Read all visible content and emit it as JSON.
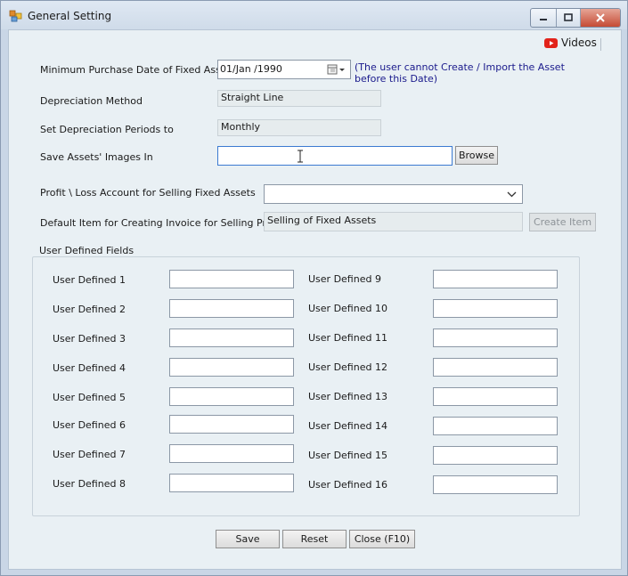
{
  "window": {
    "title": "General Setting",
    "videos_label": "Videos",
    "colors": {
      "titlebar": "#d5e0ec",
      "client": "#e9f0f4",
      "note": "#1a1a8c",
      "youtube": "#e2231a"
    }
  },
  "form": {
    "min_purchase_date": {
      "label": "Minimum Purchase Date of Fixed Assets",
      "value": "01/Jan /1990",
      "note": "(The user cannot Create / Import the Asset before this Date)"
    },
    "depreciation_method": {
      "label": "Depreciation Method",
      "value": "Straight Line"
    },
    "depreciation_periods": {
      "label": "Set Depreciation Periods to",
      "value": "Monthly"
    },
    "images_path": {
      "label": "Save Assets' Images In",
      "value": "",
      "browse_label": "Browse"
    },
    "profit_loss_account": {
      "label": "Profit \\ Loss Account for Selling Fixed Assets",
      "value": ""
    },
    "default_item": {
      "label": "Default Item for Creating Invoice for Selling Price",
      "value": "Selling of Fixed Assets",
      "create_item_label": "Create Item"
    }
  },
  "user_defined": {
    "group_title": "User Defined Fields",
    "left": [
      {
        "label": "User Defined 1",
        "value": ""
      },
      {
        "label": "User Defined 2",
        "value": ""
      },
      {
        "label": "User Defined 3",
        "value": ""
      },
      {
        "label": "User Defined 4",
        "value": ""
      },
      {
        "label": "User Defined 5",
        "value": ""
      },
      {
        "label": "User Defined 6",
        "value": ""
      },
      {
        "label": "User Defined 7",
        "value": ""
      },
      {
        "label": "User Defined 8",
        "value": ""
      }
    ],
    "right": [
      {
        "label": "User Defined 9",
        "value": ""
      },
      {
        "label": "User Defined 10",
        "value": ""
      },
      {
        "label": "User Defined 11",
        "value": ""
      },
      {
        "label": "User Defined 12",
        "value": ""
      },
      {
        "label": "User Defined 13",
        "value": ""
      },
      {
        "label": "User Defined 14",
        "value": ""
      },
      {
        "label": "User Defined 15",
        "value": ""
      },
      {
        "label": "User Defined 16",
        "value": ""
      }
    ]
  },
  "buttons": {
    "save": "Save",
    "reset": "Reset",
    "close": "Close (F10)"
  }
}
